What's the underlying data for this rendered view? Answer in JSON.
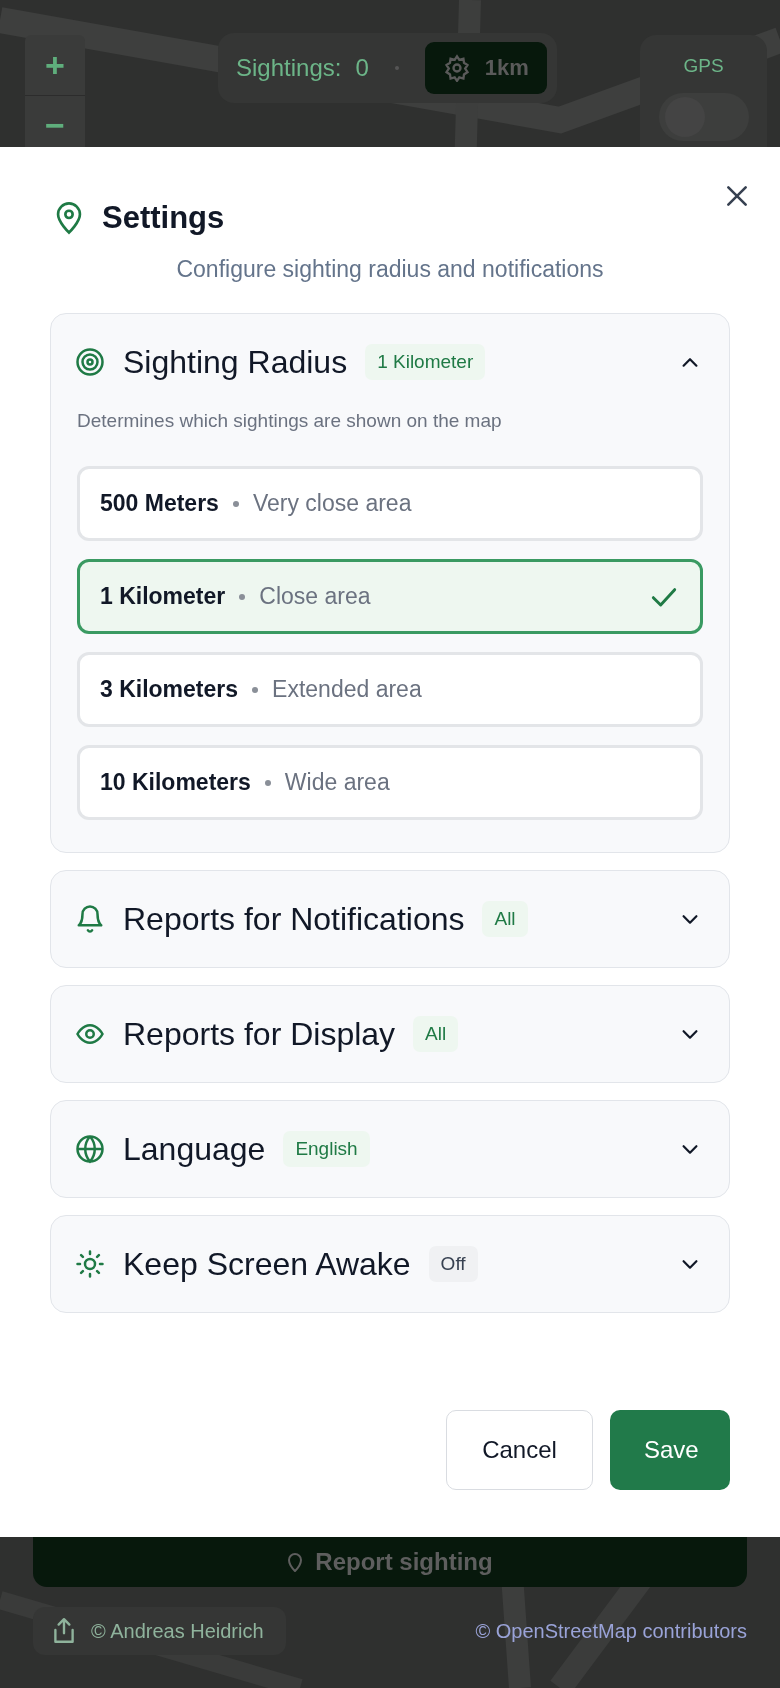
{
  "map_controls": {
    "zoom_in": "+",
    "zoom_out": "−",
    "sightings_label": "Sightings:",
    "sightings_count": "0",
    "radius_button": "1km",
    "gps": {
      "label": "GPS",
      "on": false
    }
  },
  "dialog": {
    "title": "Settings",
    "subtitle": "Configure sighting radius and notifications",
    "sections": [
      {
        "title": "Sighting Radius",
        "value": "1 Kilometer",
        "active": true,
        "expanded": true,
        "description": "Determines which sightings are shown on the map",
        "options": [
          {
            "label": "500 Meters",
            "detail": "Very close area",
            "selected": false
          },
          {
            "label": "1 Kilometer",
            "detail": "Close area",
            "selected": true
          },
          {
            "label": "3 Kilometers",
            "detail": "Extended area",
            "selected": false
          },
          {
            "label": "10 Kilometers",
            "detail": "Wide area",
            "selected": false
          }
        ]
      },
      {
        "title": "Reports for Notifications",
        "value": "All",
        "active": true,
        "expanded": false
      },
      {
        "title": "Reports for Display",
        "value": "All",
        "active": true,
        "expanded": false
      },
      {
        "title": "Language",
        "value": "English",
        "active": true,
        "expanded": false
      },
      {
        "title": "Keep Screen Awake",
        "value": "Off",
        "active": false,
        "expanded": false
      }
    ],
    "buttons": [
      {
        "label": "Cancel",
        "kind": "secondary"
      },
      {
        "label": "Save",
        "kind": "primary"
      }
    ]
  },
  "report_button": "Report sighting",
  "footer": {
    "credit": "© Andreas Heidrich",
    "attribution": "© OpenStreetMap contributors"
  }
}
